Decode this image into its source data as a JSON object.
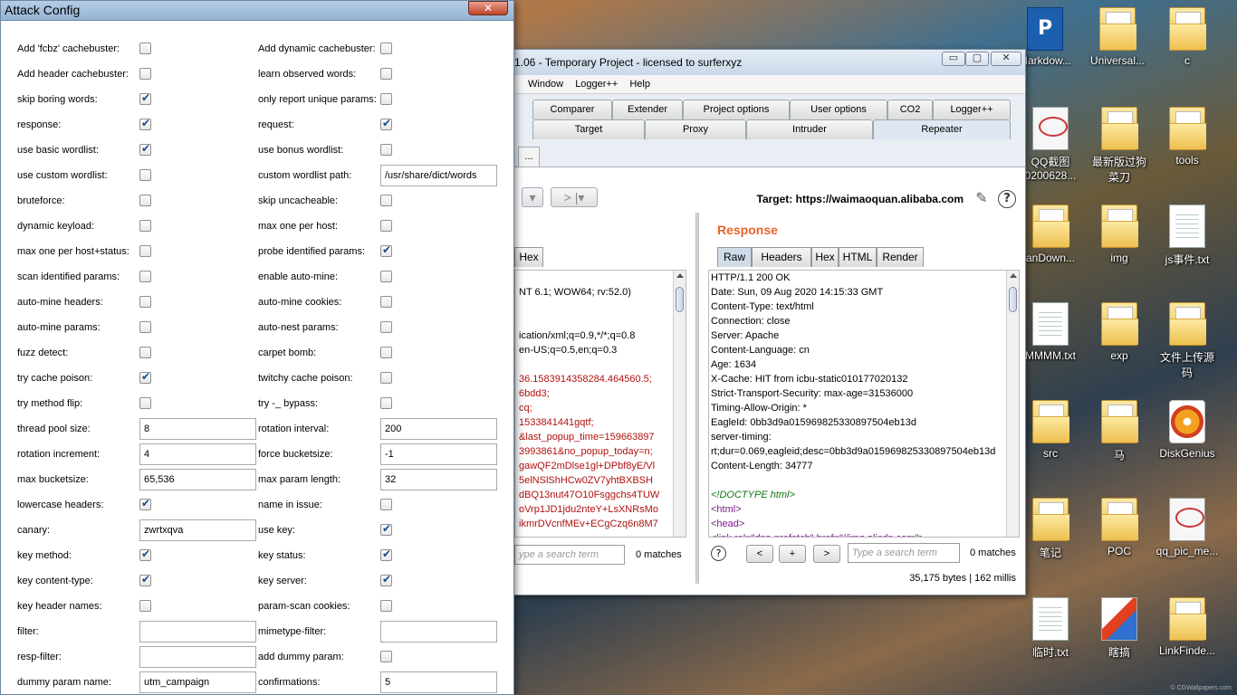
{
  "desktop": {
    "icons": [
      {
        "label": "Markdow...",
        "kind": "app"
      },
      {
        "label": "Universal...",
        "kind": "folder"
      },
      {
        "label": "c",
        "kind": "folder"
      },
      {
        "label": "QQ截图\n0200628...",
        "kind": "thumb"
      },
      {
        "label": "最新版过狗\n菜刀",
        "kind": "folder"
      },
      {
        "label": "tools",
        "kind": "folder"
      },
      {
        "label": "anDown...",
        "kind": "folder"
      },
      {
        "label": "img",
        "kind": "folder"
      },
      {
        "label": "js事件.txt",
        "kind": "file"
      },
      {
        "label": "MMMM.txt",
        "kind": "file"
      },
      {
        "label": "exp",
        "kind": "folder"
      },
      {
        "label": "文件上传源\n码",
        "kind": "folder"
      },
      {
        "label": "src",
        "kind": "folder"
      },
      {
        "label": "马",
        "kind": "folder"
      },
      {
        "label": "DiskGenius",
        "kind": "disk"
      },
      {
        "label": "笔记",
        "kind": "folder"
      },
      {
        "label": "POC",
        "kind": "folder"
      },
      {
        "label": "qq_pic_me...",
        "kind": "thumb"
      },
      {
        "label": "临时.txt",
        "kind": "file"
      },
      {
        "label": "瞎搞",
        "kind": "media"
      },
      {
        "label": "LinkFinde...",
        "kind": "folder"
      }
    ],
    "watermark": "© CGWallpapers.com"
  },
  "burp": {
    "title": "1.06 - Temporary Project - licensed to surferxyz",
    "window_buttons": [
      "▭",
      "▢",
      "✕"
    ],
    "menu": [
      "Window",
      "Logger++",
      "Help"
    ],
    "tabs_row1": [
      "Comparer",
      "Extender",
      "Project options",
      "User options",
      "CO2",
      "Logger++"
    ],
    "tabs_row2": [
      "Target",
      "Proxy",
      "Intruder",
      "Repeater"
    ],
    "active_tab": "Repeater",
    "subtab": "...",
    "nav_back": "◂",
    "nav_fwd": "> |▾",
    "target": "Target: https://waimaoquan.alibaba.com",
    "request": {
      "tab": "Hex",
      "lines": [
        {
          "t": "",
          "c": ""
        },
        {
          "t": "NT 6.1; WOW64; rv:52.0)",
          "c": ""
        },
        {
          "t": "",
          "c": ""
        },
        {
          "t": "",
          "c": ""
        },
        {
          "t": "ication/xml;q=0.9,*/*;q=0.8",
          "c": ""
        },
        {
          "t": "en-US;q=0.5,en;q=0.3",
          "c": ""
        },
        {
          "t": "",
          "c": ""
        },
        {
          "t": "36.1583914358284.464560.5;",
          "c": "red"
        },
        {
          "t": "6bdd3;",
          "c": "red"
        },
        {
          "t": "cq;",
          "c": "red"
        },
        {
          "t": "1533841441gqtf;",
          "c": "red"
        },
        {
          "t": "&last_popup_time=159663897",
          "c": "red"
        },
        {
          "t": "3993861&no_popup_today=n;",
          "c": "red"
        },
        {
          "t": "gawQF2mDlse1gl+DPbf8yE/Vl",
          "c": "red"
        },
        {
          "t": "5elNSlShHCw0ZV7yhtBXBSH",
          "c": "red"
        },
        {
          "t": "dBQ13nut47O10Fsggchs4TUW",
          "c": "red"
        },
        {
          "t": "oVrp1JD1jdu2nteY+LsXNRsMo",
          "c": "red"
        },
        {
          "t": "ikmrDVcnfMEv+ECgCzq6n8M7",
          "c": "red"
        }
      ],
      "search_placeholder": "ype a search term",
      "matches": "0 matches"
    },
    "response": {
      "title": "Response",
      "tabs": [
        "Raw",
        "Headers",
        "Hex",
        "HTML",
        "Render"
      ],
      "active": "Raw",
      "lines": [
        {
          "t": "HTTP/1.1 200 OK",
          "c": ""
        },
        {
          "t": "Date: Sun, 09 Aug 2020 14:15:33 GMT",
          "c": ""
        },
        {
          "t": "Content-Type: text/html",
          "c": ""
        },
        {
          "t": "Connection: close",
          "c": ""
        },
        {
          "t": "Server: Apache",
          "c": ""
        },
        {
          "t": "Content-Language: cn",
          "c": ""
        },
        {
          "t": "Age: 1634",
          "c": ""
        },
        {
          "t": "X-Cache: HIT from icbu-static010177020132",
          "c": ""
        },
        {
          "t": "Strict-Transport-Security: max-age=31536000",
          "c": ""
        },
        {
          "t": "Timing-Allow-Origin: *",
          "c": ""
        },
        {
          "t": "EagleId: 0bb3d9a015969825330897504eb13d",
          "c": ""
        },
        {
          "t": "server-timing:",
          "c": ""
        },
        {
          "t": "rt;dur=0.069,eagleid;desc=0bb3d9a015969825330897504eb13d",
          "c": ""
        },
        {
          "t": "Content-Length: 34777",
          "c": ""
        },
        {
          "t": "",
          "c": ""
        },
        {
          "t": "<!DOCTYPE html>",
          "c": "green"
        },
        {
          "t": "<html>",
          "c": "purple"
        },
        {
          "t": "<head>",
          "c": "purple"
        },
        {
          "t": "  <link rel=\"dns-prefetch\" href=\"//img.alicdn.com\">",
          "c": "purple"
        }
      ],
      "help": "?",
      "prev": "<",
      "add": "+",
      "next": ">",
      "search_placeholder": "Type a search term",
      "matches": "0 matches",
      "status": "35,175 bytes | 162 millis"
    }
  },
  "dialog": {
    "title": "Attack Config",
    "close": "✕",
    "rows": [
      [
        {
          "label": "Add 'fcbz' cachebuster:",
          "type": "check",
          "value": false
        },
        {
          "label": "Add dynamic cachebuster:",
          "type": "check",
          "value": false
        }
      ],
      [
        {
          "label": "Add header cachebuster:",
          "type": "check",
          "value": false
        },
        {
          "label": "learn observed words:",
          "type": "check",
          "value": false
        }
      ],
      [
        {
          "label": "skip boring words:",
          "type": "check",
          "value": true
        },
        {
          "label": "only report unique params:",
          "type": "check",
          "value": false
        }
      ],
      [
        {
          "label": "response:",
          "type": "check",
          "value": true
        },
        {
          "label": "request:",
          "type": "check",
          "value": true
        }
      ],
      [
        {
          "label": "use basic wordlist:",
          "type": "check",
          "value": true
        },
        {
          "label": "use bonus wordlist:",
          "type": "check",
          "value": false
        }
      ],
      [
        {
          "label": "use custom wordlist:",
          "type": "check",
          "value": false
        },
        {
          "label": "custom wordlist path:",
          "type": "text",
          "value": "/usr/share/dict/words"
        }
      ],
      [
        {
          "label": "bruteforce:",
          "type": "check",
          "value": false
        },
        {
          "label": "skip uncacheable:",
          "type": "check",
          "value": false
        }
      ],
      [
        {
          "label": "dynamic keyload:",
          "type": "check",
          "value": false
        },
        {
          "label": "max one per host:",
          "type": "check",
          "value": false
        }
      ],
      [
        {
          "label": "max one per host+status:",
          "type": "check",
          "value": false
        },
        {
          "label": "probe identified params:",
          "type": "check",
          "value": true
        }
      ],
      [
        {
          "label": "scan identified params:",
          "type": "check",
          "value": false
        },
        {
          "label": "enable auto-mine:",
          "type": "check",
          "value": false
        }
      ],
      [
        {
          "label": "auto-mine headers:",
          "type": "check",
          "value": false
        },
        {
          "label": "auto-mine cookies:",
          "type": "check",
          "value": false
        }
      ],
      [
        {
          "label": "auto-mine params:",
          "type": "check",
          "value": false
        },
        {
          "label": "auto-nest params:",
          "type": "check",
          "value": false
        }
      ],
      [
        {
          "label": "fuzz detect:",
          "type": "check",
          "value": false
        },
        {
          "label": "carpet bomb:",
          "type": "check",
          "value": false
        }
      ],
      [
        {
          "label": "try cache poison:",
          "type": "check",
          "value": true
        },
        {
          "label": "twitchy cache poison:",
          "type": "check",
          "value": false
        }
      ],
      [
        {
          "label": "try method flip:",
          "type": "check",
          "value": false
        },
        {
          "label": "try -_ bypass:",
          "type": "check",
          "value": false
        }
      ],
      [
        {
          "label": "thread pool size:",
          "type": "text",
          "value": "8"
        },
        {
          "label": "rotation interval:",
          "type": "text",
          "value": "200"
        }
      ],
      [
        {
          "label": "rotation increment:",
          "type": "text",
          "value": "4"
        },
        {
          "label": "force bucketsize:",
          "type": "text",
          "value": "-1"
        }
      ],
      [
        {
          "label": "max bucketsize:",
          "type": "text",
          "value": "65,536"
        },
        {
          "label": "max param length:",
          "type": "text",
          "value": "32"
        }
      ],
      [
        {
          "label": "lowercase headers:",
          "type": "check",
          "value": true
        },
        {
          "label": "name in issue:",
          "type": "check",
          "value": false
        }
      ],
      [
        {
          "label": "canary:",
          "type": "text",
          "value": "zwrtxqva"
        },
        {
          "label": "use key:",
          "type": "check",
          "value": true
        }
      ],
      [
        {
          "label": "key method:",
          "type": "check",
          "value": true
        },
        {
          "label": "key status:",
          "type": "check",
          "value": true
        }
      ],
      [
        {
          "label": "key content-type:",
          "type": "check",
          "value": true
        },
        {
          "label": "key server:",
          "type": "check",
          "value": true
        }
      ],
      [
        {
          "label": "key header names:",
          "type": "check",
          "value": false
        },
        {
          "label": "param-scan cookies:",
          "type": "check",
          "value": false
        }
      ],
      [
        {
          "label": "filter:",
          "type": "text",
          "value": ""
        },
        {
          "label": "mimetype-filter:",
          "type": "text",
          "value": ""
        }
      ],
      [
        {
          "label": "resp-filter:",
          "type": "text",
          "value": ""
        },
        {
          "label": "add dummy param:",
          "type": "check",
          "value": false
        }
      ],
      [
        {
          "label": "dummy param name:",
          "type": "text",
          "value": "utm_campaign"
        },
        {
          "label": "confirmations:",
          "type": "text",
          "value": "5"
        }
      ]
    ]
  }
}
